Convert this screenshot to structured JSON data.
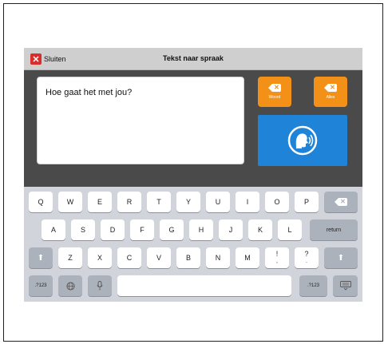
{
  "topbar": {
    "close_label": "Sluiten",
    "title": "Tekst naar spraak"
  },
  "textbox": {
    "value": "Hoe gaat het met jou?"
  },
  "buttons": {
    "word_label": "Woord",
    "all_label": "Alles"
  },
  "keyboard": {
    "row1": [
      "Q",
      "W",
      "E",
      "R",
      "T",
      "Y",
      "U",
      "I",
      "O",
      "P"
    ],
    "row2": [
      "A",
      "S",
      "D",
      "F",
      "G",
      "H",
      "J",
      "K",
      "L"
    ],
    "row3": [
      "Z",
      "X",
      "C",
      "V",
      "B",
      "N",
      "M"
    ],
    "return_label": "return",
    "punct1": [
      "!",
      ","
    ],
    "punct2": [
      "?",
      "."
    ],
    "numbers_label": ".?123"
  },
  "colors": {
    "orange": "#f39018",
    "blue": "#1f83d8",
    "red": "#d92c2c",
    "panel": "#4a4a4a"
  }
}
